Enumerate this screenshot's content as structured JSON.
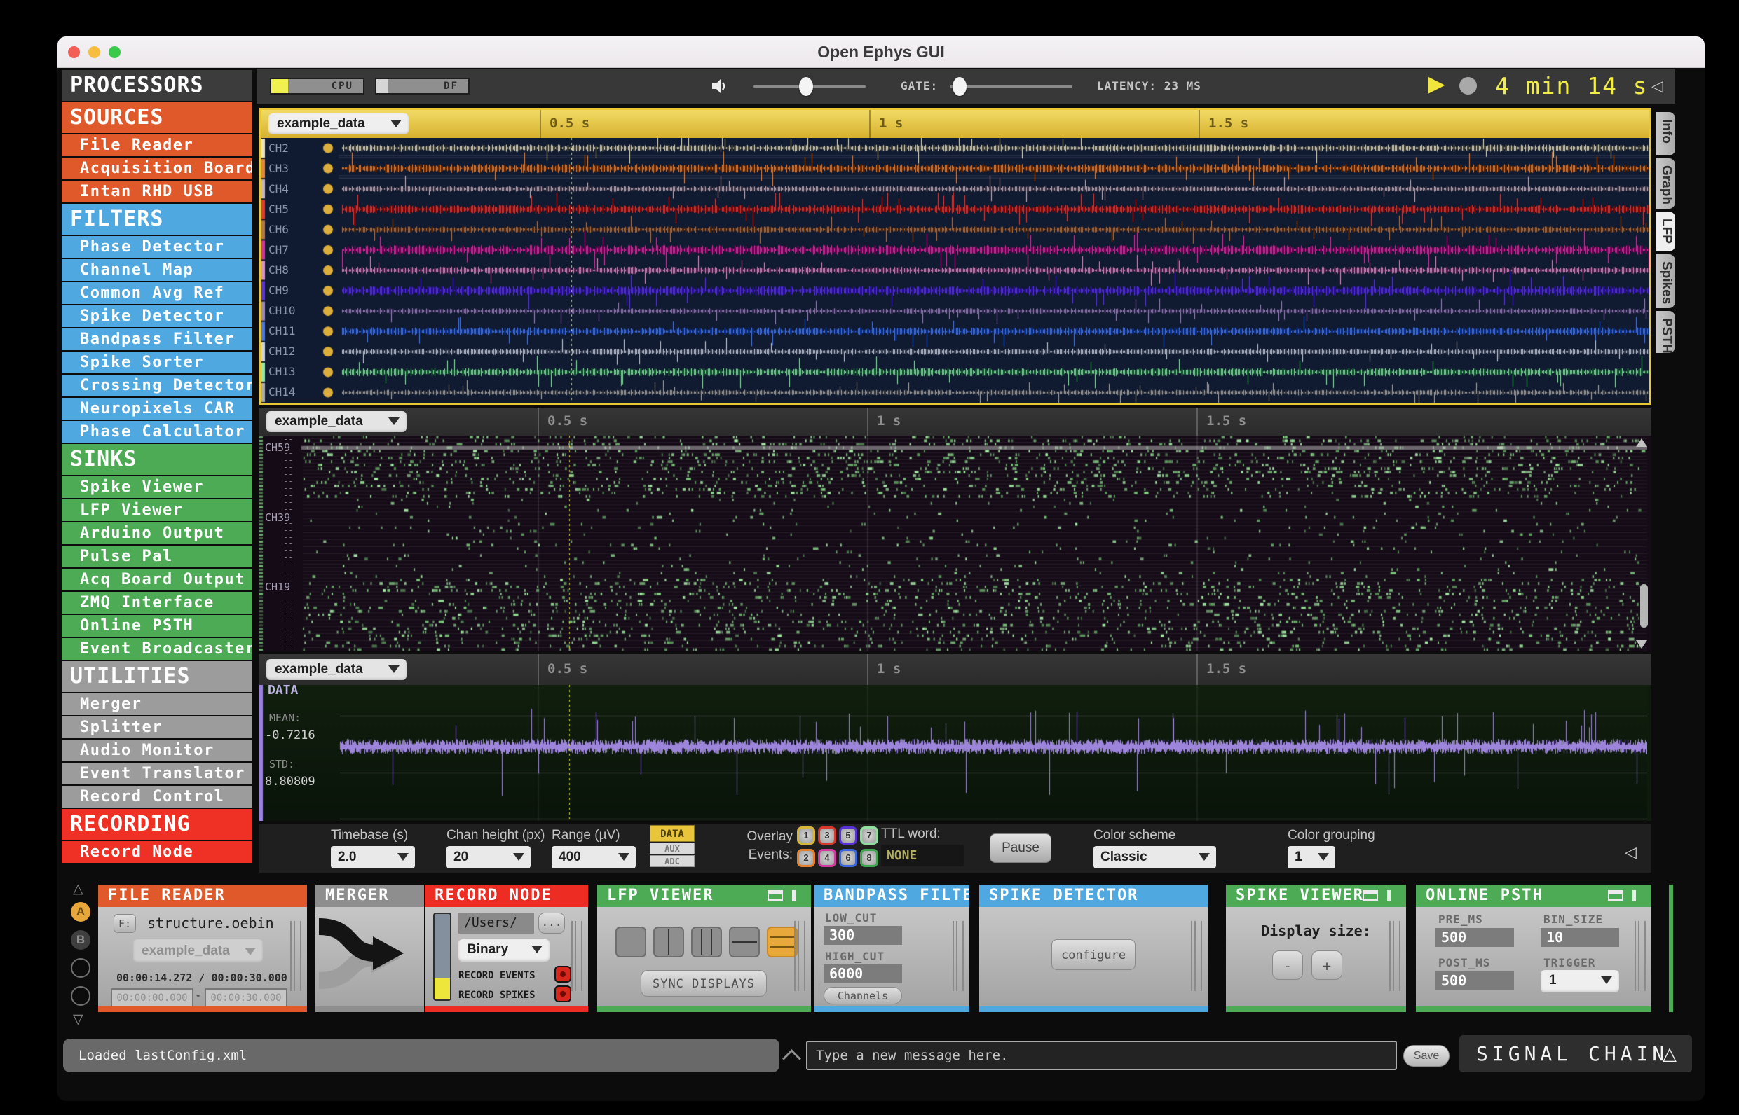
{
  "window": {
    "title": "Open Ephys GUI"
  },
  "toolbar": {
    "cpu": "CPU",
    "df": "DF",
    "gate": "GATE:",
    "latency": "LATENCY: 23 MS",
    "timer": "4 min 14 s"
  },
  "sidebar": {
    "title": "PROCESSORS",
    "sections": [
      {
        "label": "SOURCES",
        "color": "#E0592B",
        "items": [
          "File Reader",
          "Acquisition Board",
          "Intan RHD USB"
        ]
      },
      {
        "label": "FILTERS",
        "color": "#4FA8E0",
        "items": [
          "Phase Detector",
          "Channel Map",
          "Common Avg Ref",
          "Spike Detector",
          "Bandpass Filter",
          "Spike Sorter",
          "Crossing Detector",
          "Neuropixels CAR",
          "Phase Calculator"
        ]
      },
      {
        "label": "SINKS",
        "color": "#4CAB54",
        "items": [
          "Spike Viewer",
          "LFP Viewer",
          "Arduino Output",
          "Pulse Pal",
          "Acq Board Output",
          "ZMQ Interface",
          "Online PSTH",
          "Event Broadcaster"
        ]
      },
      {
        "label": "UTILITIES",
        "color": "#9C9C9C",
        "items": [
          "Merger",
          "Splitter",
          "Audio Monitor",
          "Event Translator",
          "Record Control"
        ]
      },
      {
        "label": "RECORDING",
        "color": "#EE3124",
        "items": [
          "Record Node"
        ]
      }
    ]
  },
  "viewer_tabs": [
    {
      "label": "Info",
      "selected": false
    },
    {
      "label": "Graph",
      "selected": false
    },
    {
      "label": "LFP",
      "selected": true
    },
    {
      "label": "Spikes",
      "selected": false
    },
    {
      "label": "PSTH",
      "selected": false
    }
  ],
  "panels": {
    "lfp": {
      "source": "example_data",
      "time_labels": [
        "0.5 s",
        "1 s",
        "1.5 s"
      ],
      "channels": [
        {
          "name": "CH2",
          "color": "#E8E2C8"
        },
        {
          "name": "CH3",
          "color": "#E8853C"
        },
        {
          "name": "CH4",
          "color": "#C9B6C4"
        },
        {
          "name": "CH5",
          "color": "#E23A34"
        },
        {
          "name": "CH6",
          "color": "#B4764B"
        },
        {
          "name": "CH7",
          "color": "#D633A0"
        },
        {
          "name": "CH8",
          "color": "#DE93C8"
        },
        {
          "name": "CH9",
          "color": "#5A33E2"
        },
        {
          "name": "CH10",
          "color": "#9D87BD"
        },
        {
          "name": "CH11",
          "color": "#4A79E8"
        },
        {
          "name": "CH12",
          "color": "#CBD3E3"
        },
        {
          "name": "CH13",
          "color": "#8EE8A8"
        },
        {
          "name": "CH14",
          "color": "#ACACAC"
        }
      ]
    },
    "raster": {
      "source": "example_data",
      "time_labels": [
        "0.5 s",
        "1 s",
        "1.5 s"
      ],
      "row_labels": [
        {
          "text": "CH59",
          "row": 3
        },
        {
          "text": "CH39",
          "row": 23
        },
        {
          "text": "CH19",
          "row": 43
        }
      ],
      "tick_mark": "--"
    },
    "audio": {
      "source": "example_data",
      "time_labels": [
        "0.5 s",
        "1 s",
        "1.5 s"
      ],
      "data_label": "DATA",
      "mean_label": "MEAN:",
      "mean_value": "-0.7216",
      "std_label": "STD:",
      "std_value": "8.80809"
    }
  },
  "options": {
    "timebase_label": "Timebase (s)",
    "timebase_value": "2.0",
    "chan_height_label": "Chan height (px)",
    "chan_height_value": "20",
    "range_label": "Range (µV)",
    "range_value": "400",
    "data_button": "DATA",
    "aux_button": "AUX",
    "adc_button": "ADC",
    "overlay_label_1": "Overlay",
    "overlay_label_2": "Events:",
    "event_buttons": [
      {
        "n": "1",
        "color": "#D8B63A"
      },
      {
        "n": "3",
        "color": "#D8392B"
      },
      {
        "n": "5",
        "color": "#5A30D8"
      },
      {
        "n": "7",
        "color": "#8FE0A0"
      },
      {
        "n": "2",
        "color": "#E2802F"
      },
      {
        "n": "4",
        "color": "#D23AA0"
      },
      {
        "n": "6",
        "color": "#3A66E0"
      },
      {
        "n": "8",
        "color": "#3FA64F"
      }
    ],
    "ttl_label": "TTL word:",
    "ttl_value": "NONE",
    "pause_button": "Pause",
    "scheme_label": "Color scheme",
    "scheme_value": "Classic",
    "grouping_label": "Color grouping",
    "grouping_value": "1"
  },
  "chain": {
    "file_reader": {
      "title": "FILE READER",
      "f_button": "F:",
      "file": "structure.oebin",
      "dataset": "example_data",
      "time": "00:00:14.272 / 00:00:30.000",
      "start": "00:00:00.000",
      "dash": "-",
      "end": "00:00:30.000"
    },
    "merger": {
      "title": "MERGER"
    },
    "record_node": {
      "title": "RECORD NODE",
      "path": "/Users/",
      "browse": "...",
      "engine": "Binary",
      "events_label": "RECORD EVENTS",
      "spikes_label": "RECORD SPIKES"
    },
    "lfp_viewer": {
      "title": "LFP VIEWER",
      "sync_button": "SYNC DISPLAYS"
    },
    "bandpass": {
      "title": "BANDPASS FILTER",
      "low_label": "LOW_CUT",
      "low_value": "300",
      "high_label": "HIGH_CUT",
      "high_value": "6000",
      "channels_button": "Channels"
    },
    "spike_detector": {
      "title": "SPIKE DETECTOR",
      "configure_button": "configure"
    },
    "spike_viewer": {
      "title": "SPIKE VIEWER",
      "display_label": "Display size:",
      "minus": "-",
      "plus": "+"
    },
    "online_psth": {
      "title": "ONLINE PSTH",
      "pre_label": "PRE_MS",
      "pre_value": "500",
      "bin_label": "BIN_SIZE",
      "bin_value": "10",
      "post_label": "POST_MS",
      "post_value": "500",
      "trigger_label": "TRIGGER",
      "trigger_value": "1"
    }
  },
  "rail": {
    "a": "A",
    "b": "B"
  },
  "statusbar": {
    "message": "Loaded lastConfig.xml",
    "placeholder": "Type a new message here.",
    "save_button": "Save",
    "signal_chain": "SIGNAL CHAIN"
  },
  "colors": {
    "accent_yellow": "#E8C835",
    "timer_yellow": "#F2EC48",
    "header_orange": "#E0592B",
    "header_blue": "#4FA8E0",
    "header_green": "#4CAB54",
    "header_gray": "#9C9C9C",
    "header_red": "#EE3124",
    "raster_green": "#79C279",
    "audio_trace": "#A78BE8",
    "lfp_bg": "#101A30",
    "raster_bg": "#150B17",
    "audio_bg": "#0E1C0C"
  }
}
